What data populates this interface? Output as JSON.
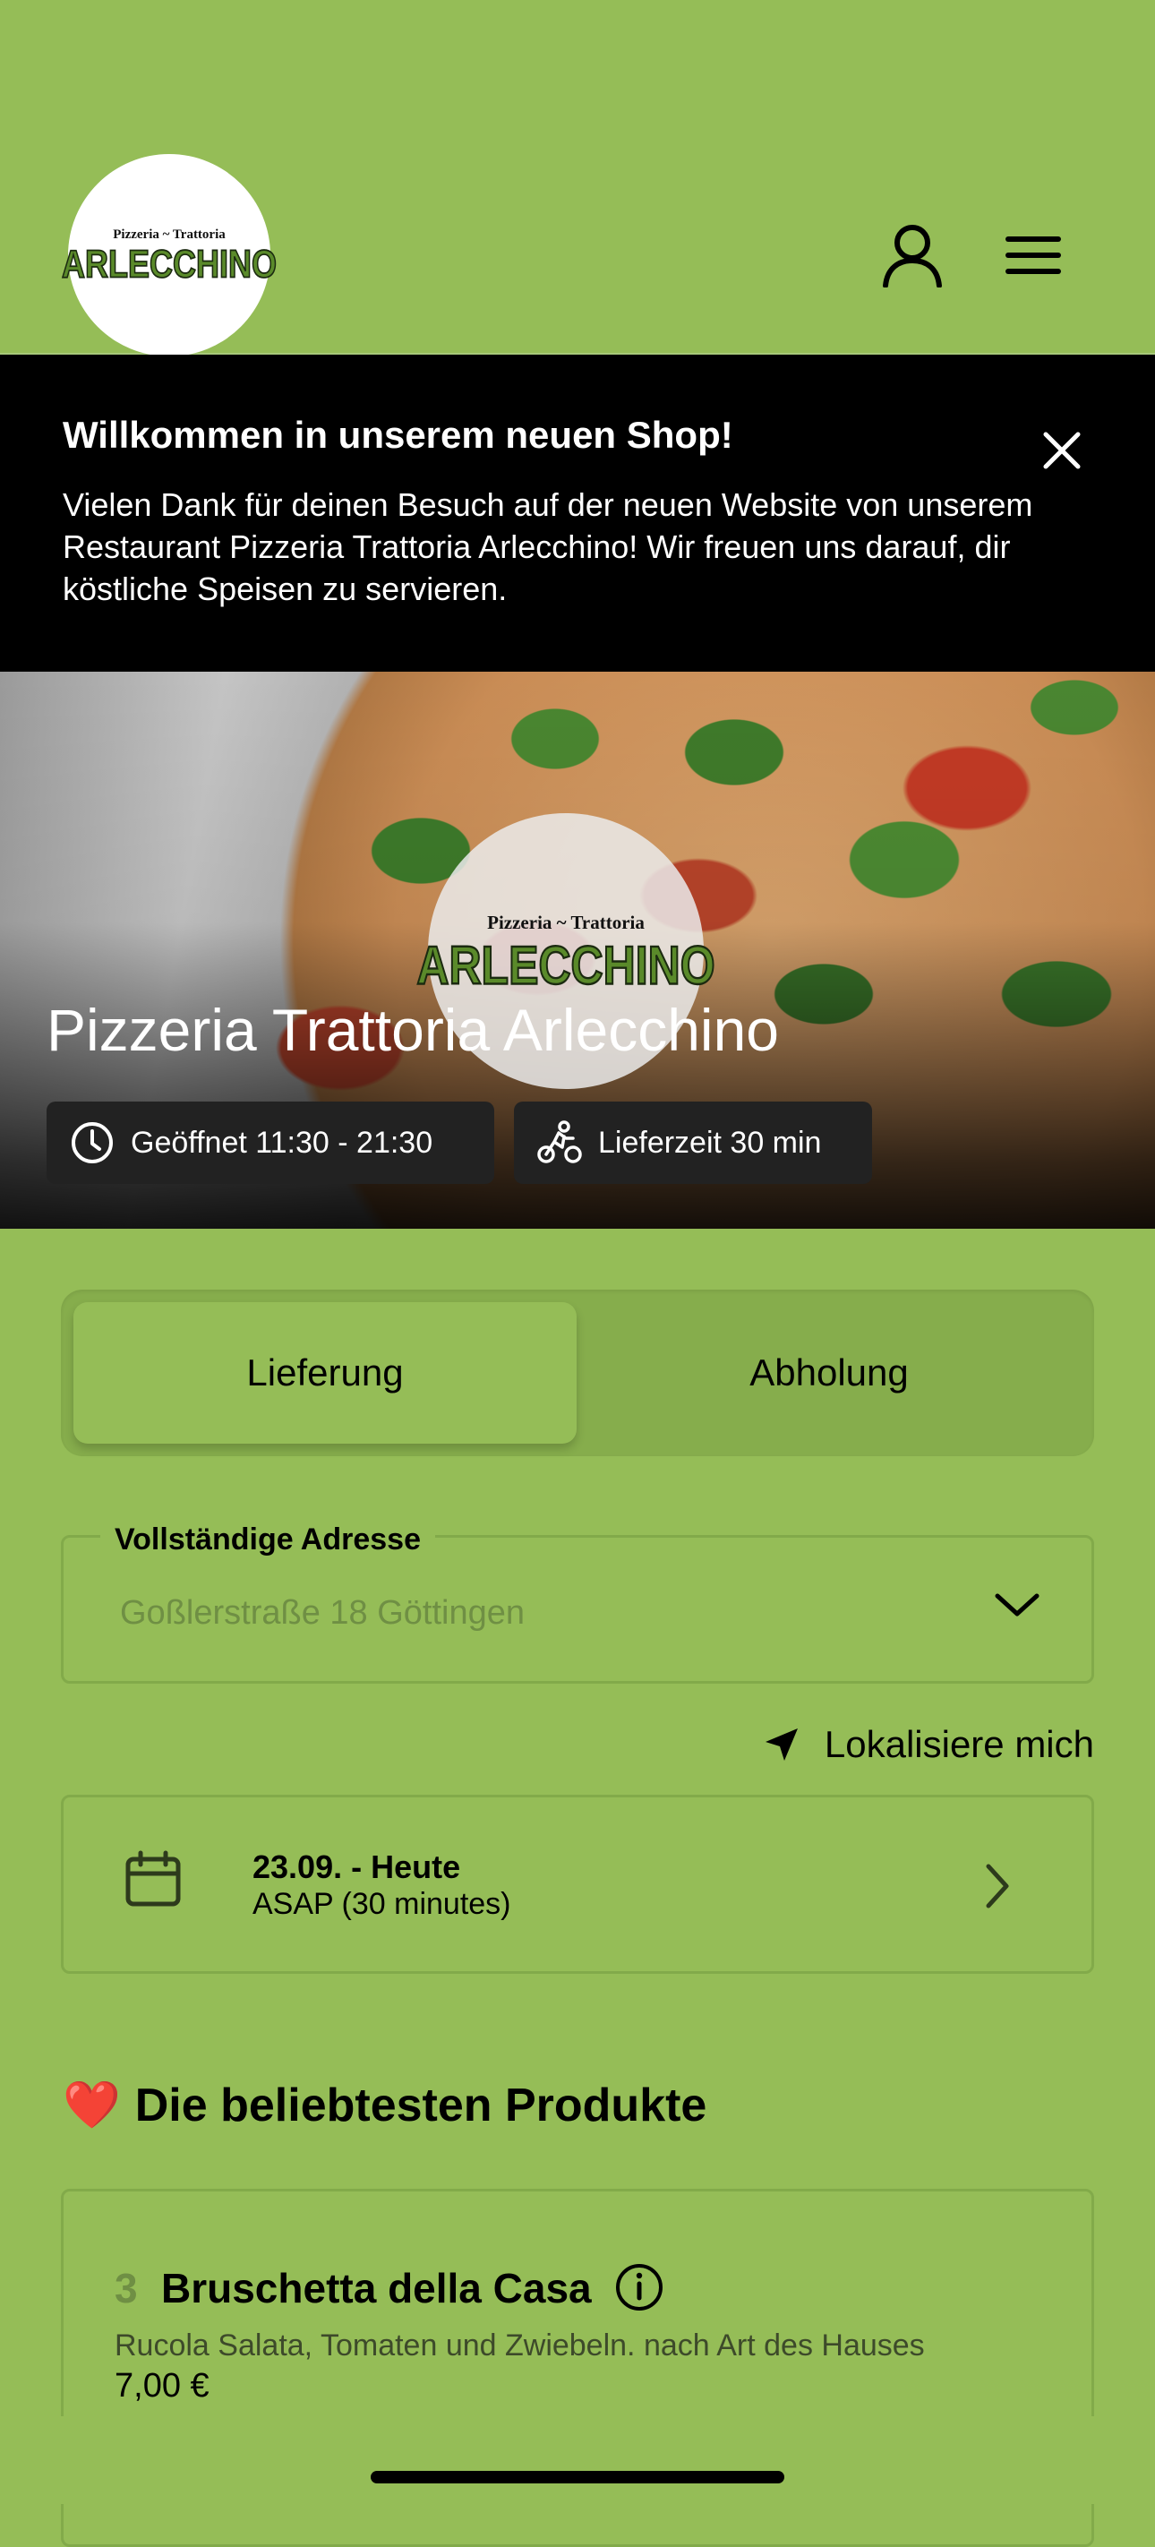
{
  "brand": {
    "logo_line1": "Pizzeria ~ Trattoria",
    "logo_line2": "ARLECCHINO"
  },
  "header": {
    "account_icon": "user-icon",
    "menu_icon": "hamburger-menu-icon"
  },
  "banner": {
    "title": "Willkommen in unserem neuen Shop!",
    "text": "Vielen Dank für deinen Besuch auf der neuen Website von unserem Restaurant Pizzeria Trattoria Arlecchino! Wir freuen uns darauf, dir köstliche Speisen zu servieren.",
    "close_icon": "close-icon"
  },
  "hero": {
    "title": "Pizzeria Trattoria Arlecchino",
    "opening_hours": "Geöffnet 11:30 - 21:30",
    "delivery_time": "Lieferzeit 30 min"
  },
  "order_mode": {
    "delivery_label": "Lieferung",
    "pickup_label": "Abholung",
    "selected": "Lieferung"
  },
  "address": {
    "label": "Vollständige Adresse",
    "placeholder": "Goßlerstraße 18 Göttingen"
  },
  "locate": {
    "label": "Lokalisiere mich"
  },
  "schedule": {
    "date": "23.09. - Heute",
    "time": "ASAP (30 minutes)"
  },
  "popular": {
    "emoji": "❤️",
    "title": "Die beliebtesten Produkte",
    "products": [
      {
        "number": "3",
        "name": "Bruschetta della Casa",
        "description": "Rucola Salata, Tomaten und Zwiebeln. nach Art des Hauses",
        "price": "7,00 €"
      }
    ]
  },
  "colors": {
    "background": "#95bd57",
    "banner": "#000000",
    "toggle_track": "#86ad4c",
    "border": "#82aa4a"
  }
}
